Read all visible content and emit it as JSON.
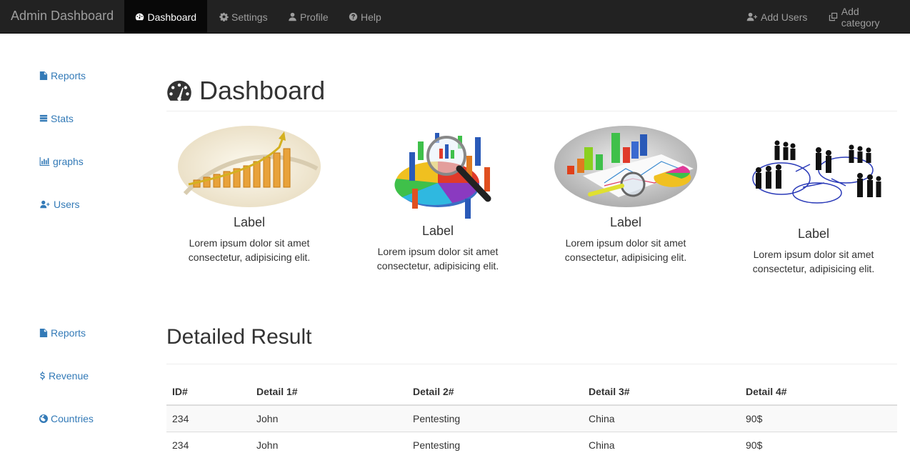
{
  "navbar": {
    "brand": "Admin Dashboard",
    "items": [
      {
        "label": "Dashboard",
        "icon": "dashboard-icon",
        "active": true
      },
      {
        "label": "Settings",
        "icon": "gear-icon"
      },
      {
        "label": "Profile",
        "icon": "user-icon"
      },
      {
        "label": "Help",
        "icon": "question-circle-icon"
      }
    ],
    "right_items": [
      {
        "label": "Add Users",
        "icon": "user-plus-icon"
      },
      {
        "label": "Add category",
        "icon": "clone-icon"
      }
    ]
  },
  "sidebar": {
    "group1": [
      {
        "label": "Reports",
        "icon": "file-icon"
      },
      {
        "label": "Stats",
        "icon": "database-icon"
      },
      {
        "label": "graphs",
        "icon": "bar-chart-icon"
      },
      {
        "label": "Users",
        "icon": "user-plus-icon"
      }
    ],
    "group2": [
      {
        "label": "Reports",
        "icon": "file-icon"
      },
      {
        "label": "Revenue",
        "icon": "dollar-icon"
      },
      {
        "label": "Countries",
        "icon": "globe-icon"
      }
    ]
  },
  "main": {
    "title": "Dashboard",
    "title_icon": "dashboard-icon",
    "thumbnails": [
      {
        "label": "Label",
        "desc_line1": "Lorem ipsum dolor sit amet",
        "desc_line2": "consectetur, adipisicing elit.",
        "image": "growth-bar-chart-image"
      },
      {
        "label": "Label",
        "desc_line1": "Lorem ipsum dolor sit amet",
        "desc_line2": "consectetur, adipisicing elit.",
        "image": "pie-chart-magnifier-image"
      },
      {
        "label": "Label",
        "desc_line1": "Lorem ipsum dolor sit amet",
        "desc_line2": "consectetur, adipisicing elit.",
        "image": "charts-on-paper-image"
      },
      {
        "label": "Label",
        "desc_line1": "Lorem ipsum dolor sit amet",
        "desc_line2": "consectetur, adipisicing elit.",
        "image": "business-people-network-image"
      }
    ],
    "section_title": "Detailed Result",
    "table": {
      "headers": [
        "ID#",
        "Detail 1#",
        "Detail 2#",
        "Detail 3#",
        "Detail 4#"
      ],
      "rows": [
        [
          "234",
          "John",
          "Pentesting",
          "China",
          "90$"
        ],
        [
          "234",
          "John",
          "Pentesting",
          "China",
          "90$"
        ]
      ]
    }
  },
  "colors": {
    "navbar": "#222222",
    "link": "#337ab7",
    "active_nav": "#080808"
  }
}
